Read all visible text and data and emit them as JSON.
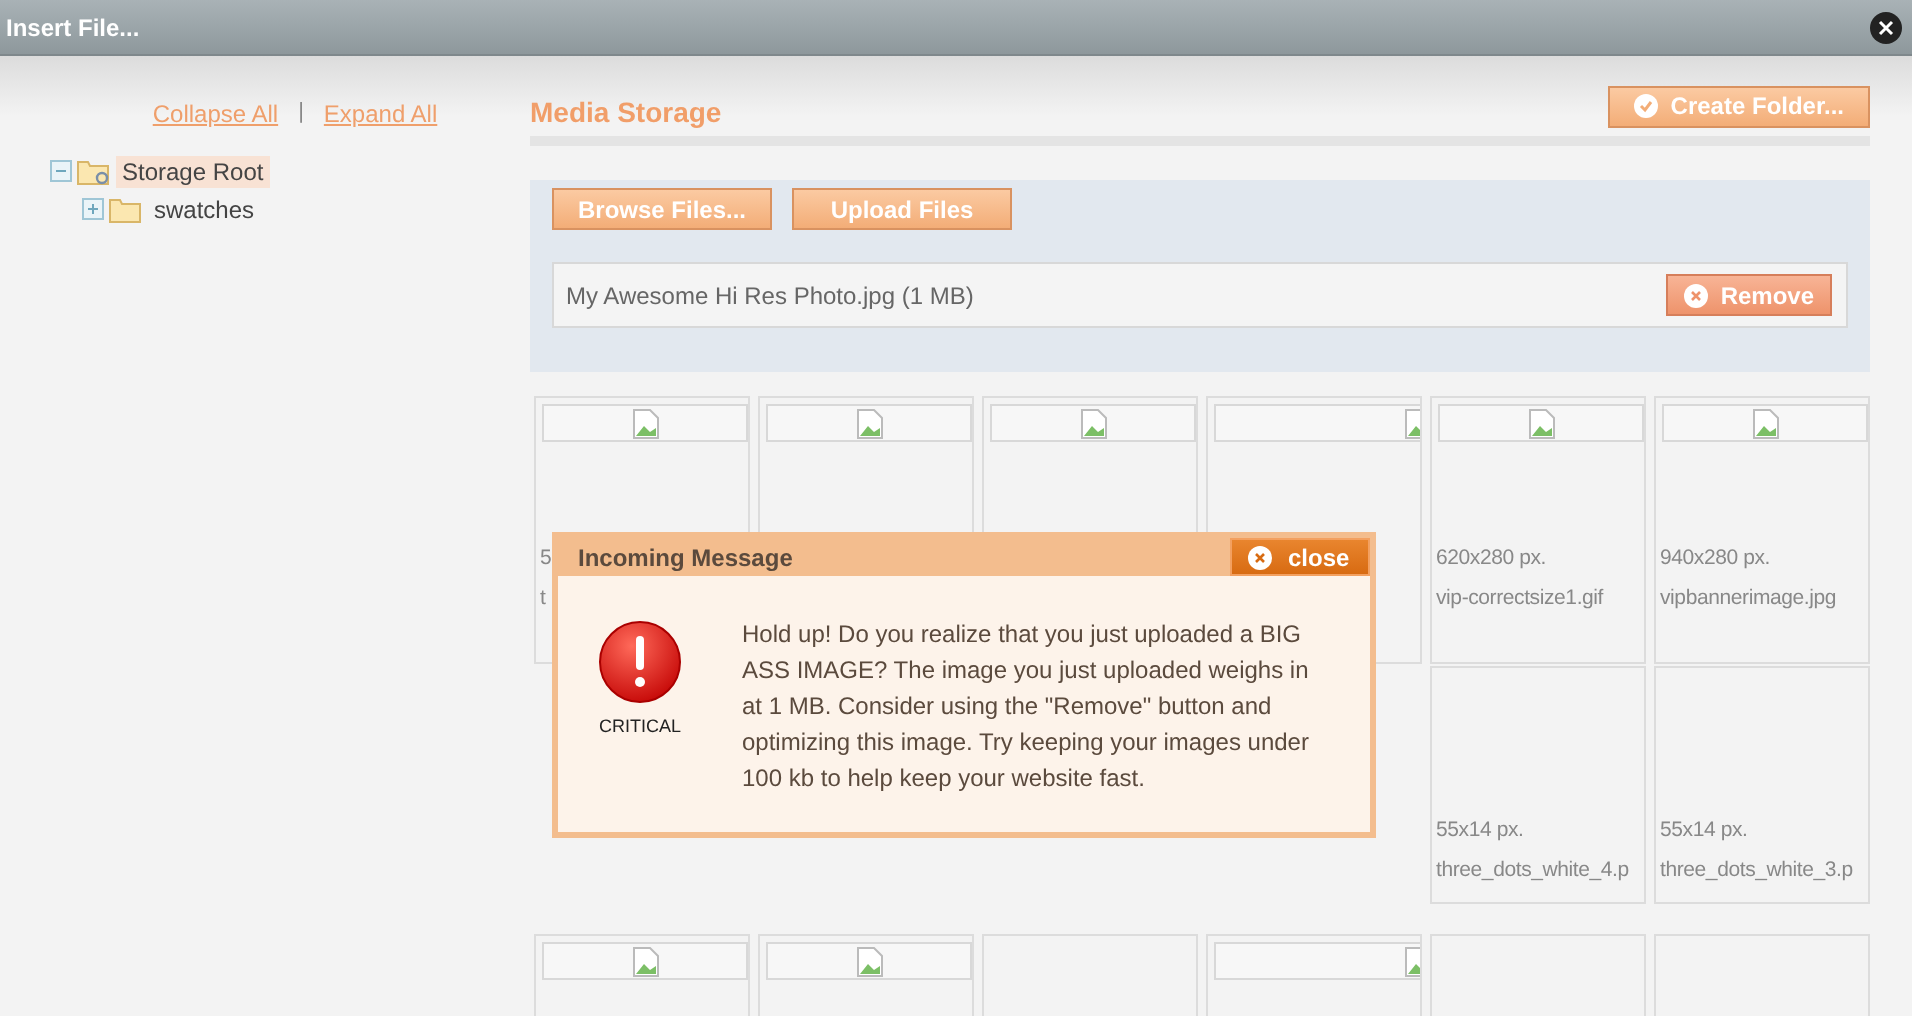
{
  "window": {
    "title": "Insert File..."
  },
  "tree_links": [
    "Collapse All",
    "|",
    "Expand All"
  ],
  "tree": [
    {
      "label": "Storage Root",
      "expanded": true,
      "selected": true,
      "children": [
        {
          "label": "swatches",
          "expanded": false,
          "selected": false
        }
      ]
    }
  ],
  "media": {
    "title": "Media Storage",
    "create_button": "Create Folder..."
  },
  "uploader": {
    "buttons": [
      "Browse Files...",
      "Upload Files"
    ],
    "files": [
      {
        "name": "My Awesome Hi Res Photo.jpg (1 MB)",
        "remove_label": "Remove"
      }
    ]
  },
  "thumbnail_rows": [
    {
      "cells": [
        {
          "kind": "broken-image",
          "dims": "5",
          "name": "t"
        },
        {
          "kind": "broken-image"
        },
        {
          "kind": "broken-image"
        },
        {
          "kind": "wide-frame"
        },
        {
          "kind": "broken-image",
          "dims": "620x280 px.",
          "name": "vip-correctsize1.gif"
        },
        {
          "kind": "broken-image",
          "dims": "940x280 px.",
          "name": "vipbannerimage.jpg"
        }
      ]
    },
    {
      "cells": [
        {
          "kind": "empty",
          "dims": "55x14 px.",
          "name": "three_dots_white_4.p"
        },
        {
          "kind": "empty",
          "dims": "55x14 px.",
          "name": "three_dots_white_3.p"
        }
      ]
    },
    {
      "cells": [
        {
          "kind": "broken-image"
        },
        {
          "kind": "broken-image"
        },
        {
          "kind": "empty"
        },
        {
          "kind": "wide-frame"
        },
        {
          "kind": "empty"
        },
        {
          "kind": "empty"
        }
      ]
    }
  ],
  "message": {
    "title": "Incoming Message",
    "close_label": "close",
    "severity": "CRITICAL",
    "text": "Hold up! Do you realize that you just uploaded a BIG ASS IMAGE? The image you just uploaded weighs in at 1 MB. Consider using the \"Remove\" button and optimizing this image. Try keeping your images under 100 kb to help keep your website fast."
  }
}
